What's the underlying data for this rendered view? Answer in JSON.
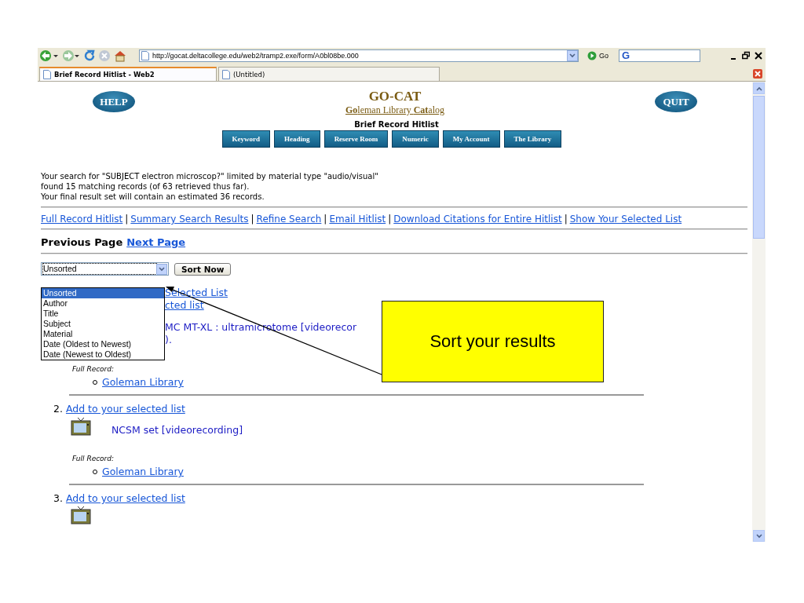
{
  "browser": {
    "address": "http://gocat.deltacollege.edu/web2/tramp2.exe/form/A0bl08be.000",
    "go_label": "Go",
    "search_logo": "G"
  },
  "tabs": [
    {
      "label": "Brief Record Hitlist - Web2",
      "selected": true
    },
    {
      "label": "(Untitled)",
      "selected": false
    }
  ],
  "header": {
    "help": "HELP",
    "title": "GO-CAT",
    "subtitle": "**Go**leman Library **Cat**alog",
    "page_title": "Brief Record Hitlist",
    "quit": "QUIT"
  },
  "nav": [
    "Keyword",
    "Heading",
    "Reserve Room",
    "Numeric",
    "My Account",
    "The Library"
  ],
  "summary": [
    "Your search for \"SUBJECT electron microscop?\" limited by material type \"audio/visual\"",
    "found 15 matching records (of 63 retrieved thus far).",
    "Your final result set will contain an estimated 36 records."
  ],
  "links": {
    "separator": "|",
    "items": [
      "Full Record Hitlist",
      "Summary Search Results",
      "Refine Search",
      "Email Hitlist",
      "Download Citations for Entire Hitlist",
      "Show Your Selected List"
    ]
  },
  "paging": {
    "previous": "Previous Page",
    "next": "Next Page"
  },
  "sort": {
    "value": "Unsorted",
    "button": "Sort Now",
    "expanded": true,
    "options": [
      {
        "label": "Unsorted",
        "selected": true
      },
      {
        "label": "Author",
        "selected": false
      },
      {
        "label": "Title",
        "selected": false
      },
      {
        "label": "Subject",
        "selected": false
      },
      {
        "label": "Material",
        "selected": false
      },
      {
        "label": "Date (Oldest to Newest)",
        "selected": false
      },
      {
        "label": "Date (Newest to Oldest)",
        "selected": false
      }
    ]
  },
  "first_record": {
    "links": [
      "Selected List",
      "cted list"
    ],
    "title": "MC MT-XL : ultramicrotome [videorecor",
    "title_end": ").",
    "full_record_label": "Full Record:",
    "location": "Goleman Library"
  },
  "records": [
    {
      "number": "2.",
      "add_link": "Add to your selected list",
      "title": "NCSM set [videorecording]",
      "full_record_label": "Full Record:",
      "location": "Goleman Library"
    },
    {
      "number": "3.",
      "add_link": "Add to your selected list"
    }
  ],
  "callout": {
    "text": "Sort your results"
  }
}
